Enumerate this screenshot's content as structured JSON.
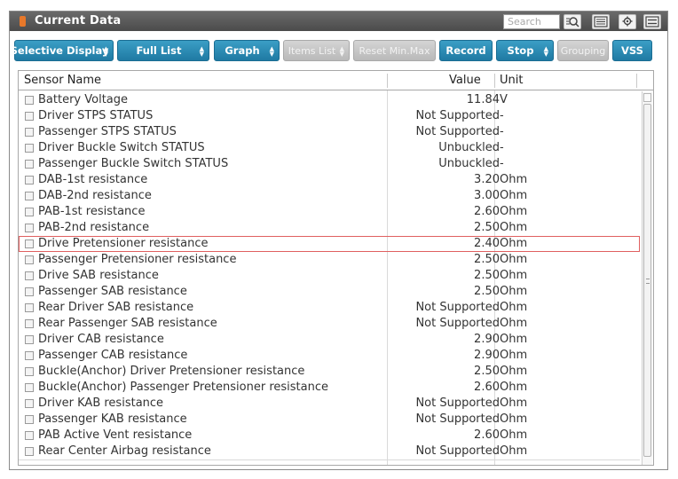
{
  "window": {
    "title": "Current Data"
  },
  "search": {
    "placeholder": "Search"
  },
  "toolbar": {
    "buttons": [
      {
        "label": "Selective Display",
        "dropdown": true,
        "enabled": true
      },
      {
        "label": "Full List",
        "dropdown": true,
        "enabled": true
      },
      {
        "label": "Graph",
        "dropdown": true,
        "enabled": true
      },
      {
        "label": "Items List",
        "dropdown": true,
        "enabled": false
      },
      {
        "label": "Reset Min.Max",
        "dropdown": false,
        "enabled": false
      },
      {
        "label": "Record",
        "dropdown": false,
        "enabled": true
      },
      {
        "label": "Stop",
        "dropdown": true,
        "enabled": true
      },
      {
        "label": "Grouping",
        "dropdown": false,
        "enabled": false
      },
      {
        "label": "VSS",
        "dropdown": false,
        "enabled": true
      }
    ],
    "icons": [
      "magnify-list-icon",
      "list-icon",
      "setting-icon",
      "menu-icon"
    ]
  },
  "table": {
    "columns": {
      "name": "Sensor Name",
      "value": "Value",
      "unit": "Unit"
    },
    "selected_index": 9,
    "rows": [
      {
        "name": "Battery Voltage",
        "value": "11.84",
        "unit": "V"
      },
      {
        "name": "Driver STPS STATUS",
        "value": "Not Supported",
        "unit": "-"
      },
      {
        "name": "Passenger STPS STATUS",
        "value": "Not Supported",
        "unit": "-"
      },
      {
        "name": "Driver Buckle Switch STATUS",
        "value": "Unbuckled",
        "unit": "-"
      },
      {
        "name": "Passenger Buckle Switch STATUS",
        "value": "Unbuckled",
        "unit": "-"
      },
      {
        "name": "DAB-1st resistance",
        "value": "3.20",
        "unit": "Ohm"
      },
      {
        "name": "DAB-2nd resistance",
        "value": "3.00",
        "unit": "Ohm"
      },
      {
        "name": "PAB-1st resistance",
        "value": "2.60",
        "unit": "Ohm"
      },
      {
        "name": "PAB-2nd resistance",
        "value": "2.50",
        "unit": "Ohm"
      },
      {
        "name": "Drive Pretensioner resistance",
        "value": "2.40",
        "unit": "Ohm"
      },
      {
        "name": "Passenger Pretensioner resistance",
        "value": "2.50",
        "unit": "Ohm"
      },
      {
        "name": "Drive SAB resistance",
        "value": "2.50",
        "unit": "Ohm"
      },
      {
        "name": "Passenger SAB resistance",
        "value": "2.50",
        "unit": "Ohm"
      },
      {
        "name": "Rear Driver SAB resistance",
        "value": "Not Supported",
        "unit": "Ohm"
      },
      {
        "name": "Rear Passenger SAB resistance",
        "value": "Not Supported",
        "unit": "Ohm"
      },
      {
        "name": "Driver CAB resistance",
        "value": "2.90",
        "unit": "Ohm"
      },
      {
        "name": "Passenger CAB resistance",
        "value": "2.90",
        "unit": "Ohm"
      },
      {
        "name": "Buckle(Anchor) Driver Pretensioner resistance",
        "value": "2.50",
        "unit": "Ohm"
      },
      {
        "name": "Buckle(Anchor) Passenger Pretensioner resistance",
        "value": "2.60",
        "unit": "Ohm"
      },
      {
        "name": "Driver KAB resistance",
        "value": "Not Supported",
        "unit": "Ohm"
      },
      {
        "name": "Passenger KAB resistance",
        "value": "Not Supported",
        "unit": "Ohm"
      },
      {
        "name": "PAB Active Vent resistance",
        "value": "2.60",
        "unit": "Ohm"
      },
      {
        "name": "Rear Center Airbag resistance",
        "value": "Not Supported",
        "unit": "Ohm"
      }
    ]
  },
  "colors": {
    "button_blue": "#2a8bb5",
    "button_disabled": "#c4c4c4",
    "titlebar": "#555555",
    "selected_outline": "#e06060"
  }
}
